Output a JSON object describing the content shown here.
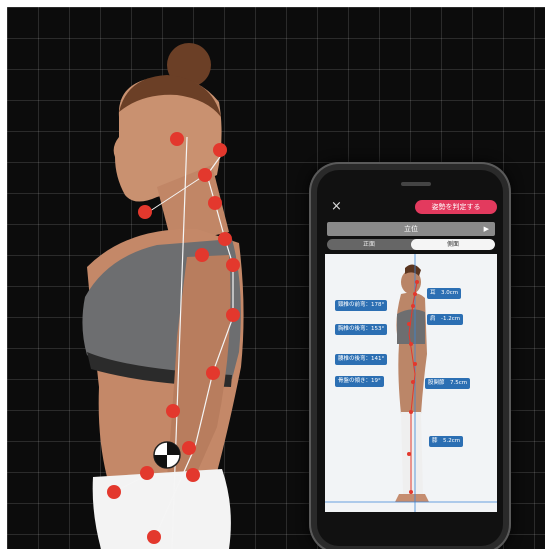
{
  "app": {
    "close_icon": "×",
    "judge_button": "姿勢を判定する",
    "mode_title": "立位",
    "play_icon": "▶",
    "tabs": [
      "正面",
      "側面"
    ],
    "active_tab": "側面"
  },
  "measurements": {
    "left": [
      "頸椎の前弯：178°",
      "胸椎の後弯：153°",
      "腰椎の後弯：141°",
      "骨盤の傾き：19°"
    ],
    "right": [
      "耳　3.0cm",
      "肩　-1.2cm",
      "股関節　7.5cm",
      "膝　5.2cm"
    ]
  },
  "colors": {
    "marker": "#e3382d",
    "accent_button": "#e33a5e",
    "tag": "#2c6fb3"
  }
}
